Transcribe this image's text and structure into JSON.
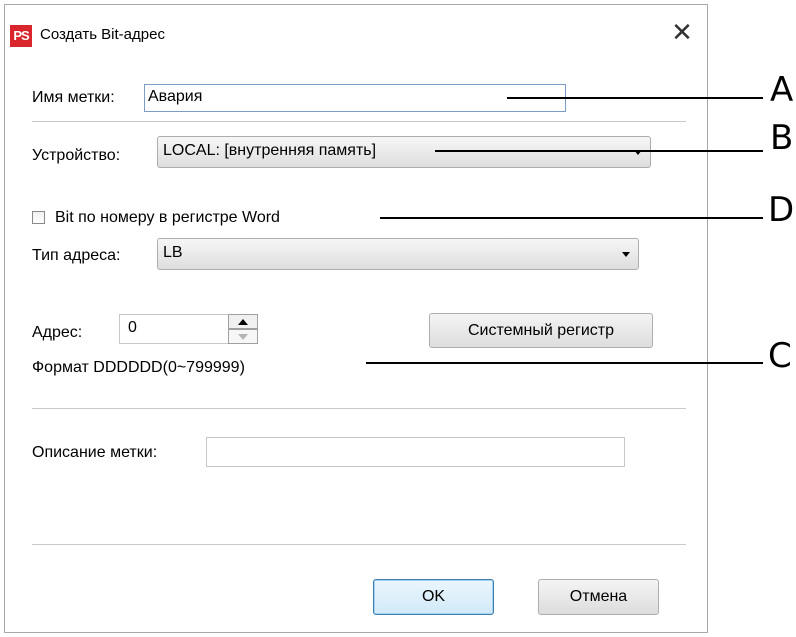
{
  "window": {
    "logo_text": "PS",
    "title": "Создать Bit-адрес",
    "close_glyph": "✕"
  },
  "tag_name": {
    "label": "Имя метки:",
    "value": "Авария"
  },
  "device": {
    "label": "Устройство:",
    "selected": "LOCAL: [внутренняя память]"
  },
  "bit_by_word": {
    "label": "Bit по номеру в регистре Word",
    "checked": false
  },
  "address_type": {
    "label": "Тип адреса:",
    "selected": "LB"
  },
  "address": {
    "label": "Адрес:",
    "value": "0",
    "format": "Формат DDDDDD(0~799999)"
  },
  "system_register_button": "Системный регистр",
  "description": {
    "label": "Описание метки:",
    "value": ""
  },
  "buttons": {
    "ok": "OK",
    "cancel": "Отмена"
  },
  "annotations": [
    "A",
    "B",
    "D",
    "C"
  ],
  "colors": {
    "logo": "#d9252c",
    "input_border": "#7a9cc6",
    "ok_border": "#3c7fb1"
  }
}
